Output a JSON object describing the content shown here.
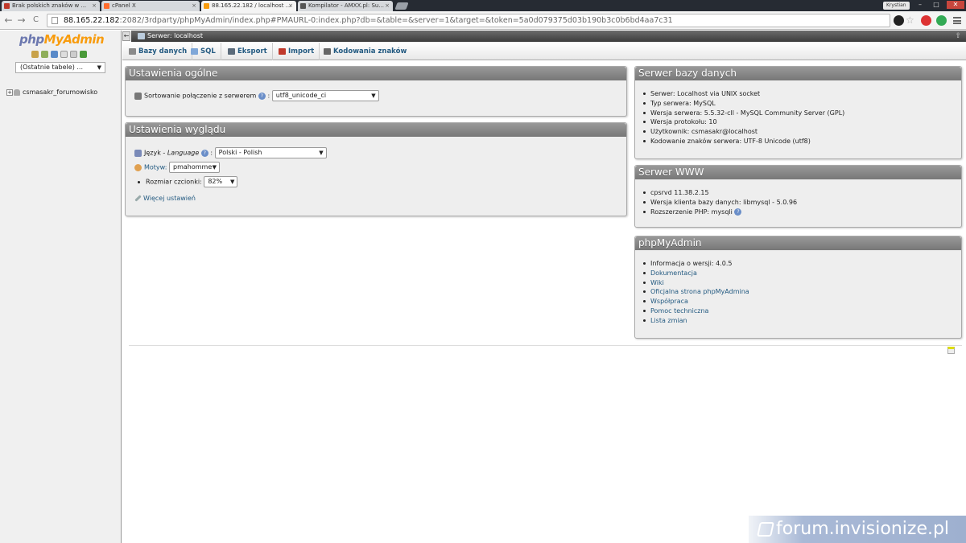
{
  "browser": {
    "tabs": [
      {
        "title": "Brak polskich znaków w ...",
        "fav_color": "#c0392b"
      },
      {
        "title": "cPanel X",
        "fav_color": "#ff6c2c"
      },
      {
        "title": "88.165.22.182 / localhost ...",
        "fav_color": "#f89c0e"
      },
      {
        "title": "Kompilator - AMXX.pl: Su...",
        "fav_color": "#555555"
      }
    ],
    "close_glyph": "×",
    "user": "Krystian",
    "url_host": "88.165.22.182",
    "url_rest": ":2082/3rdparty/phpMyAdmin/index.php#PMAURL-0:index.php?db=&table=&server=1&target=&token=5a0d079375d03b190b3c0b6bd4aa7c31",
    "back_glyph": "←",
    "forward_glyph": "→",
    "reload_glyph": "C",
    "star_glyph": "☆",
    "win_min": "–",
    "win_max": "□",
    "win_close": "✕"
  },
  "sidebar": {
    "logo_php": "php",
    "logo_myadmin": "MyAdmin",
    "recent_tables": "(Ostatnie tabele) ...",
    "databases": [
      {
        "name": "csmasakr_forumowisko"
      }
    ],
    "expand_glyph": "+"
  },
  "serverbar": {
    "label": "Serwer: localhost",
    "collapse_glyph": "←",
    "up_glyph": "⇧"
  },
  "toptabs": [
    {
      "label": "Bazy danych",
      "icon_color": "#8a8a8a"
    },
    {
      "label": "SQL",
      "icon_color": "#7fa7d8"
    },
    {
      "label": "Eksport",
      "icon_color": "#5a6a7a"
    },
    {
      "label": "Import",
      "icon_color": "#c0392b"
    },
    {
      "label": "Kodowania znaków",
      "icon_color": "#666666"
    }
  ],
  "general_settings": {
    "title": "Ustawienia ogólne",
    "collation_label": "Sortowanie połączenie z serwerem",
    "collation_value": "utf8_unicode_ci",
    "colon": ":"
  },
  "appearance_settings": {
    "title": "Ustawienia wyglądu",
    "language_label": "Język - ",
    "language_label_em": "Language",
    "language_value": "Polski - Polish",
    "theme_label": "Motyw:",
    "theme_value": "pmahomme",
    "font_size_label": "Rozmiar czcionki:",
    "font_size_value": "82%",
    "more_settings": "Więcej ustawień",
    "colon": ":"
  },
  "db_server": {
    "title": "Serwer bazy danych",
    "items": [
      "Serwer: Localhost via UNIX socket",
      "Typ serwera: MySQL",
      "Wersja serwera: 5.5.32-cll - MySQL Community Server (GPL)",
      "Wersja protokołu: 10",
      "Użytkownik: csmasakr@localhost",
      "Kodowanie znaków serwera: UTF-8 Unicode (utf8)"
    ]
  },
  "web_server": {
    "title": "Serwer WWW",
    "items": [
      "cpsrvd 11.38.2.15",
      "Wersja klienta bazy danych: libmysql - 5.0.96",
      "Rozszerzenie PHP: mysqli"
    ]
  },
  "pma": {
    "title": "phpMyAdmin",
    "version": "Informacja o wersji: 4.0.5",
    "links": [
      "Dokumentacja",
      "Wiki",
      "Oficjalna strona phpMyAdmina",
      "Współpraca",
      "Pomoc techniczna",
      "Lista zmian"
    ]
  },
  "help_glyph": "?",
  "select_arrow": "▼",
  "watermark": "forum.invisionize.pl"
}
